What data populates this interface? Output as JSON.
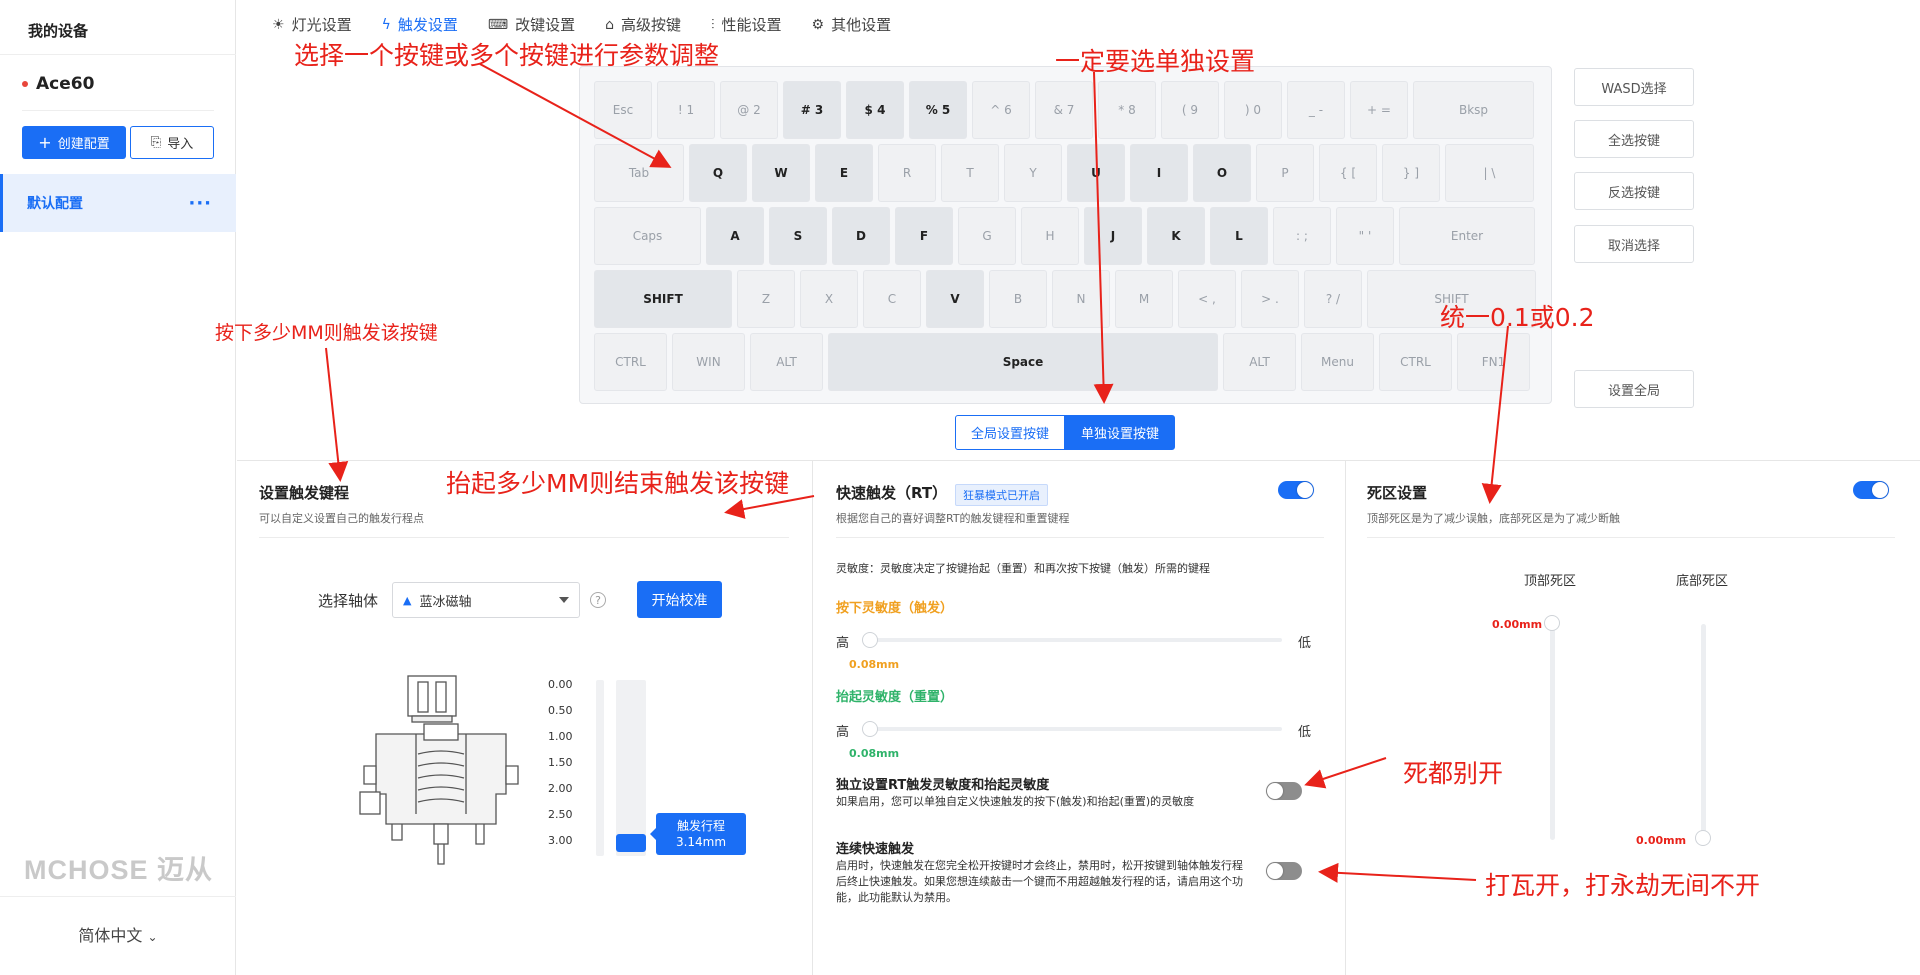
{
  "sidebar": {
    "title": "我的设备",
    "device_name": "Ace60",
    "create_label": "创建配置",
    "import_label": "导入",
    "config_item": "默认配置",
    "more": "···",
    "logo": "MCHOSE 迈从",
    "language": "简体中文"
  },
  "tabs": [
    {
      "label": "灯光设置",
      "icon": "bulb-icon"
    },
    {
      "label": "触发设置",
      "icon": "lightning-icon"
    },
    {
      "label": "改键设置",
      "icon": "keyboard-icon"
    },
    {
      "label": "高级按键",
      "icon": "advanced-key-icon"
    },
    {
      "label": "性能设置",
      "icon": "sliders-icon"
    },
    {
      "label": "其他设置",
      "icon": "gear-icon"
    }
  ],
  "keyboard": {
    "rows": [
      [
        [
          "Esc",
          false
        ],
        [
          "! 1",
          false
        ],
        [
          "@ 2",
          false
        ],
        [
          "# 3",
          true
        ],
        [
          "$ 4",
          true
        ],
        [
          "% 5",
          true
        ],
        [
          "^ 6",
          false
        ],
        [
          "& 7",
          false
        ],
        [
          "* 8",
          false
        ],
        [
          "( 9",
          false
        ],
        [
          ") 0",
          false
        ],
        [
          "_ -",
          false
        ],
        [
          "+ =",
          false
        ],
        [
          "Bksp",
          false
        ]
      ],
      [
        [
          "Tab",
          false
        ],
        [
          "Q",
          true
        ],
        [
          "W",
          true
        ],
        [
          "E",
          true
        ],
        [
          "R",
          false
        ],
        [
          "T",
          false
        ],
        [
          "Y",
          false
        ],
        [
          "U",
          true
        ],
        [
          "I",
          true
        ],
        [
          "O",
          true
        ],
        [
          "P",
          false
        ],
        [
          "{ [",
          false
        ],
        [
          "} ]",
          false
        ],
        [
          "| \\",
          false
        ]
      ],
      [
        [
          "Caps",
          false
        ],
        [
          "A",
          true
        ],
        [
          "S",
          true
        ],
        [
          "D",
          true
        ],
        [
          "F",
          true
        ],
        [
          "G",
          false
        ],
        [
          "H",
          false
        ],
        [
          "J",
          true
        ],
        [
          "K",
          true
        ],
        [
          "L",
          true
        ],
        [
          ": ;",
          false
        ],
        [
          "\" '",
          false
        ],
        [
          "Enter",
          false
        ]
      ],
      [
        [
          "SHIFT",
          true
        ],
        [
          "Z",
          false
        ],
        [
          "X",
          false
        ],
        [
          "C",
          false
        ],
        [
          "V",
          true
        ],
        [
          "B",
          false
        ],
        [
          "N",
          false
        ],
        [
          "M",
          false
        ],
        [
          "< ,",
          false
        ],
        [
          "> .",
          false
        ],
        [
          "? /",
          false
        ],
        [
          "SHIFT",
          false
        ]
      ],
      [
        [
          "CTRL",
          false
        ],
        [
          "WIN",
          false
        ],
        [
          "ALT",
          false
        ],
        [
          "Space",
          true
        ],
        [
          "ALT",
          false
        ],
        [
          "Menu",
          false
        ],
        [
          "CTRL",
          false
        ],
        [
          "FN1",
          false
        ]
      ]
    ]
  },
  "side_buttons": {
    "wasd": "WASD选择",
    "select_all": "全选按键",
    "invert": "反选按键",
    "cancel": "取消选择",
    "set_global": "设置全局"
  },
  "mode_segment": {
    "global": "全局设置按键",
    "single": "单独设置按键"
  },
  "trigger_panel": {
    "title": "设置触发键程",
    "subtitle": "可以自定义设置自己的触发行程点",
    "axis_label": "选择轴体",
    "axis_value": "蓝冰磁轴",
    "help": "?",
    "calibrate": "开始校准",
    "scale": [
      "0.00",
      "0.50",
      "1.00",
      "1.50",
      "2.00",
      "2.50",
      "3.00"
    ],
    "travel_label": "触发行程",
    "travel_value": "3.14mm",
    "travel_fraction": 0.95
  },
  "rt_panel": {
    "title": "快速触发（RT）",
    "badge": "狂暴模式已开启",
    "subtitle": "根据您自己的喜好调整RT的触发键程和重置键程",
    "enabled": true,
    "sens_desc": "灵敏度：灵敏度决定了按键抬起（重置）和再次按下按键（触发）所需的键程",
    "press_title": "按下灵敏度（触发）",
    "press_value": "0.08mm",
    "release_title": "抬起灵敏度（重置）",
    "release_value": "0.08mm",
    "high": "高",
    "low": "低",
    "independent_title": "独立设置RT触发灵敏度和抬起灵敏度",
    "independent_desc": "如果启用，您可以单独自定义快速触发的按下(触发)和抬起(重置)的灵敏度",
    "independent_enabled": false,
    "continuous_title": "连续快速触发",
    "continuous_desc_1": "启用时，快速触发在您完全松开按键时才会终止，禁用时，松开按键到轴体触发行程",
    "continuous_desc_2": "后终止快速触发。如果您想连续敲击一个键而不用超越触发行程的话，请启用这个功",
    "continuous_desc_3": "能，此功能默认为禁用。",
    "continuous_enabled": false
  },
  "deadzone_panel": {
    "title": "死区设置",
    "subtitle": "顶部死区是为了减少误触，底部死区是为了减少断触",
    "enabled": true,
    "top_label": "顶部死区",
    "bottom_label": "底部死区",
    "top_value": "0.00mm",
    "bottom_value": "0.00mm"
  },
  "annotations": {
    "a1": "选择一个按键或多个按键进行参数调整",
    "a2": "一定要选单独设置",
    "a3": "按下多少MM则触发该按键",
    "a4": "抬起多少MM则结束触发该按键",
    "a5": "统一0.1或0.2",
    "a6": "死都别开",
    "a7": "打瓦开，打永劫无间不开"
  },
  "colors": {
    "accent": "#1a6ef5",
    "annotation": "#e8221a",
    "press_orange": "#f0a020",
    "release_green": "#2fb36a",
    "value_red": "#e8221a"
  }
}
